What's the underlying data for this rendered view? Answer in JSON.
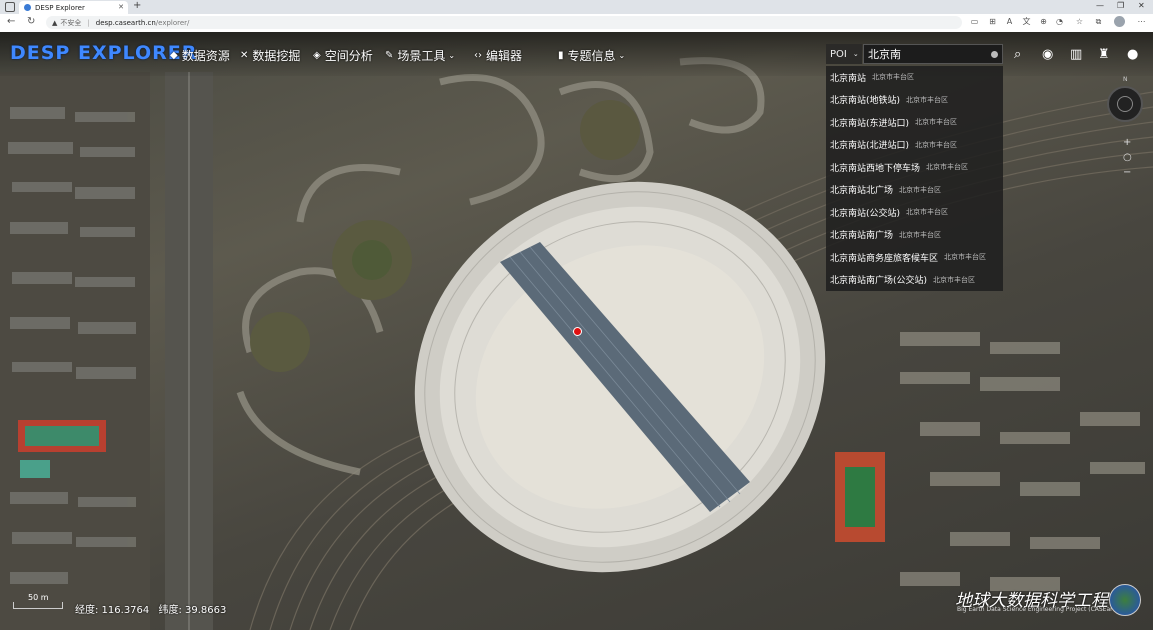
{
  "browser": {
    "tab_title": "DESP Explorer",
    "new_tab": "+",
    "tab_close": "✕",
    "nav_back": "←",
    "nav_refresh": "↻",
    "security_warning": "▲",
    "security_text": "不安全",
    "url_host": "desp.casearth.cn",
    "url_path": "/explorer/",
    "win_minimize": "—",
    "win_restore": "❐",
    "win_close": "✕"
  },
  "app": {
    "logo": "DESP EXPLORER",
    "nav": [
      {
        "label": "数据资源",
        "icon": "layers-icon",
        "glyph": "◆",
        "dropdown": false
      },
      {
        "label": "数据挖掘",
        "icon": "tools-icon",
        "glyph": "✕",
        "dropdown": false
      },
      {
        "label": "空间分析",
        "icon": "cube-icon",
        "glyph": "◈",
        "dropdown": false
      },
      {
        "label": "场景工具",
        "icon": "wrench-icon",
        "glyph": "✎",
        "dropdown": true
      },
      {
        "label": "编辑器",
        "icon": "code-icon",
        "glyph": "‹›",
        "dropdown": false
      },
      {
        "label": "专题信息",
        "icon": "bookmark-icon",
        "glyph": "▮",
        "dropdown": true
      }
    ],
    "chevron": "⌄"
  },
  "search": {
    "type_label": "POI",
    "query": "北京南",
    "results": [
      {
        "name": "北京南站",
        "district": "北京市丰台区"
      },
      {
        "name": "北京南站(地铁站)",
        "district": "北京市丰台区"
      },
      {
        "name": "北京南站(东进站口)",
        "district": "北京市丰台区"
      },
      {
        "name": "北京南站(北进站口)",
        "district": "北京市丰台区"
      },
      {
        "name": "北京南站西地下停车场",
        "district": "北京市丰台区"
      },
      {
        "name": "北京南站北广场",
        "district": "北京市丰台区"
      },
      {
        "name": "北京南站(公交站)",
        "district": "北京市丰台区"
      },
      {
        "name": "北京南站南广场",
        "district": "北京市丰台区"
      },
      {
        "name": "北京南站商务座旅客候车区",
        "district": "北京市丰台区"
      },
      {
        "name": "北京南站南广场(公交站)",
        "district": "北京市丰台区"
      }
    ]
  },
  "toolbar_icons": [
    "search-icon",
    "globe-icon",
    "map-icon",
    "shirt-icon",
    "user-icon"
  ],
  "map": {
    "compass_label": "N",
    "zoom_in": "+",
    "zoom_out": "−",
    "scale_label": "50 m",
    "longitude_label": "经度: 116.3764",
    "latitude_label": "纬度: 39.8663",
    "watermark_title": "地球大数据科学工程",
    "watermark_subtitle": "Big Earth Data Science Engineering Project (CASEarth)"
  },
  "colors": {
    "logo": "#3f88ff",
    "marker": "#e01010"
  }
}
